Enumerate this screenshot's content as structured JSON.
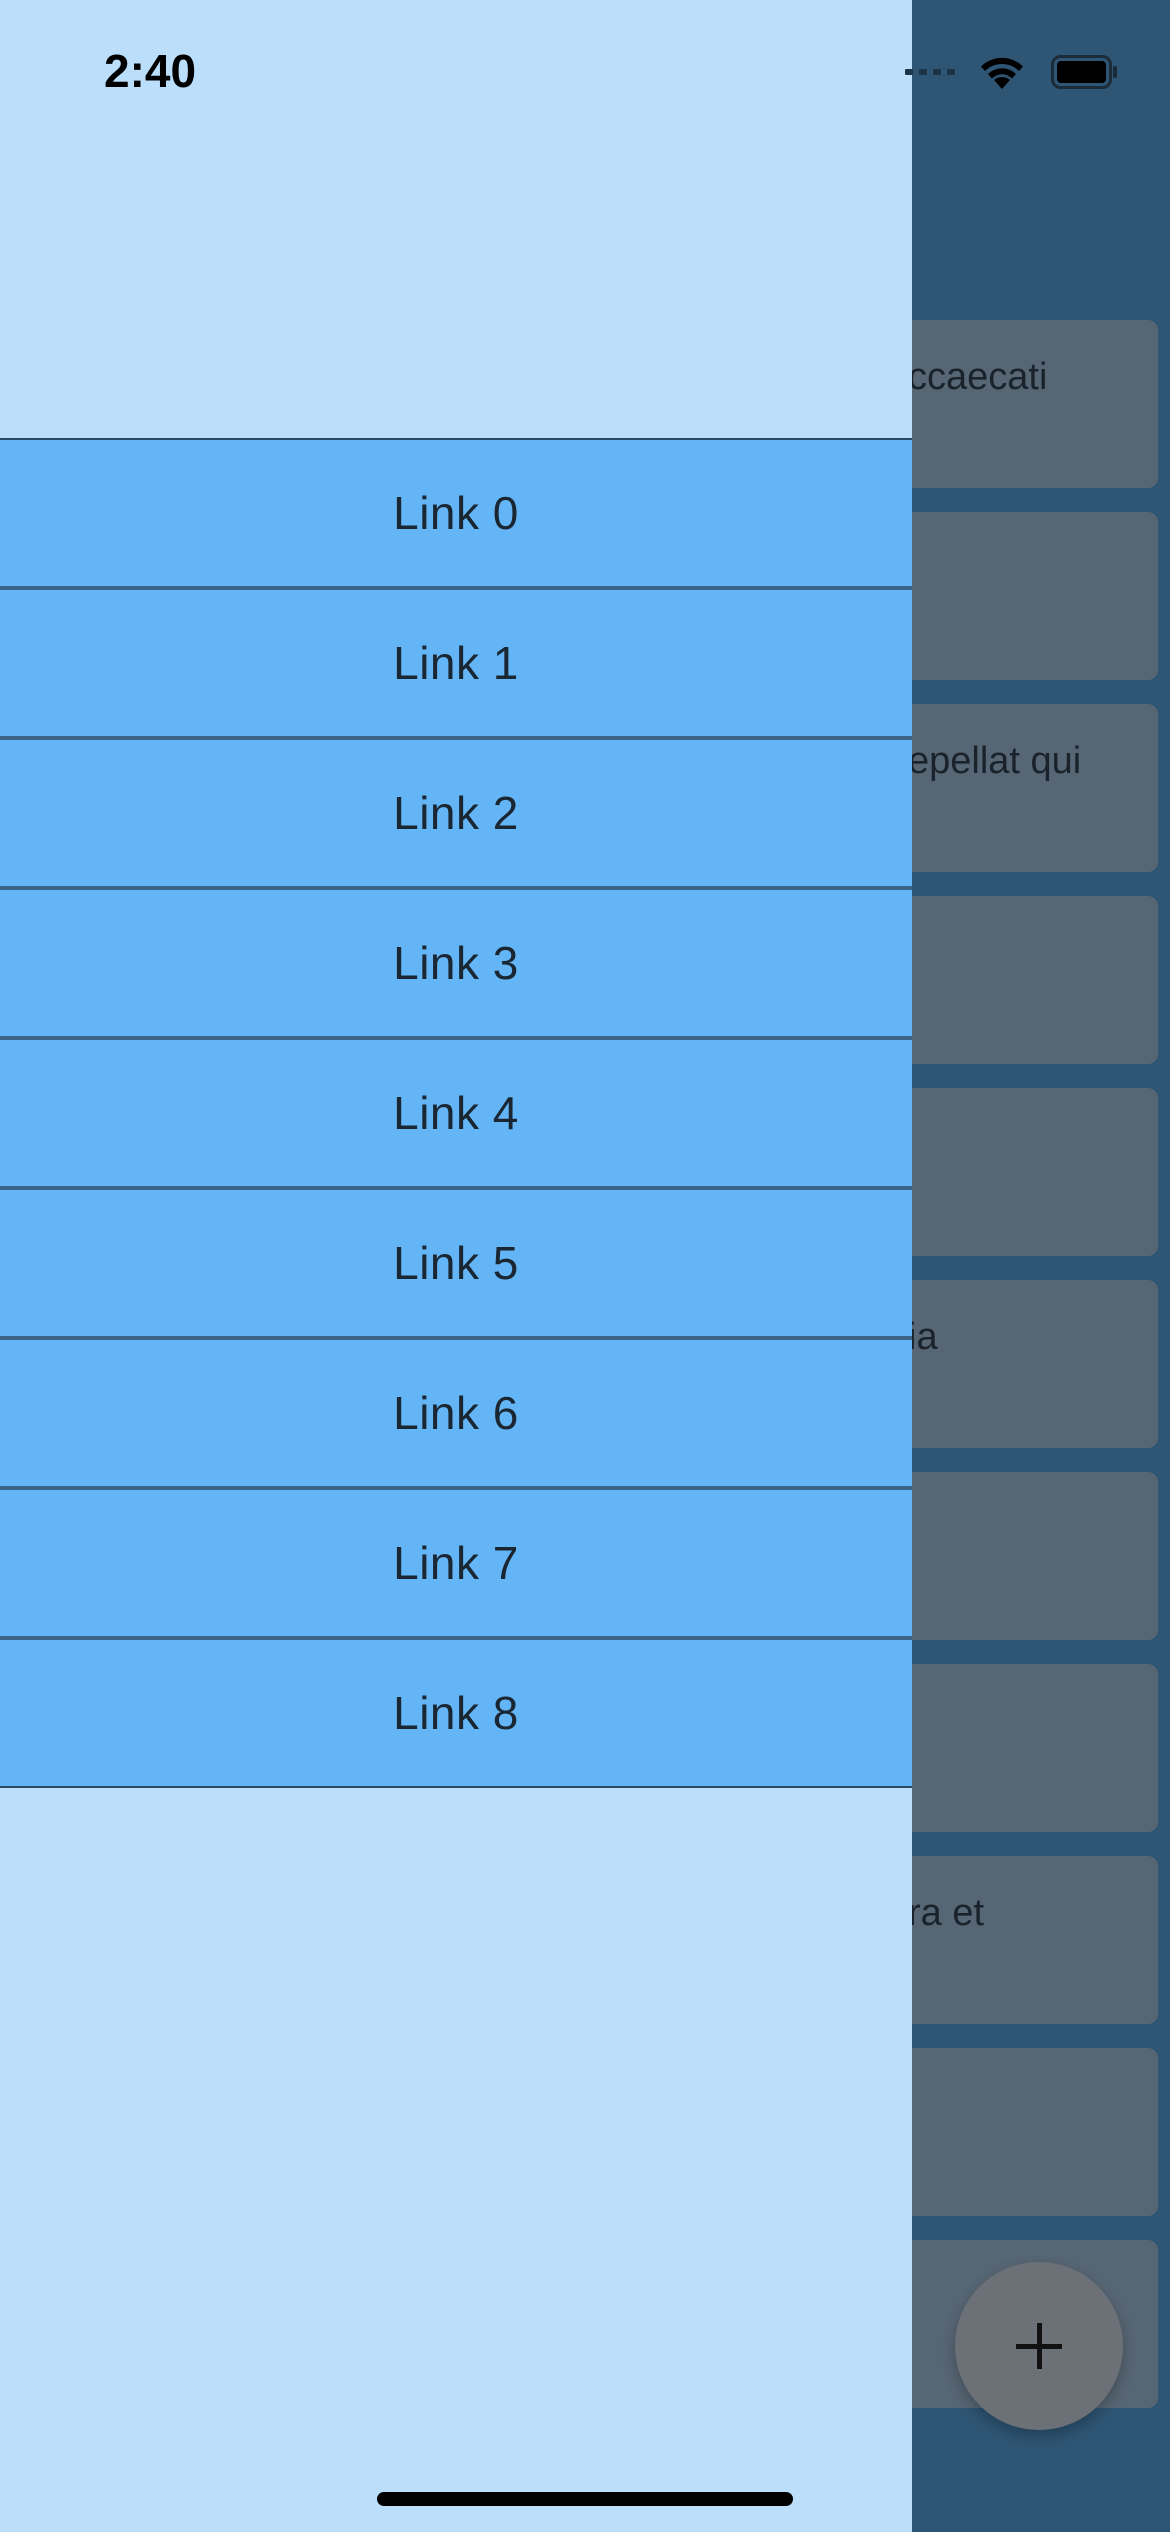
{
  "status_bar": {
    "time": "2:40",
    "wifi_icon": "wifi-icon",
    "battery_icon": "battery-icon"
  },
  "drawer": {
    "links": [
      {
        "label": "Link 0"
      },
      {
        "label": "Link 1"
      },
      {
        "label": "Link 2"
      },
      {
        "label": "Link 3"
      },
      {
        "label": "Link 4"
      },
      {
        "label": "Link 5"
      },
      {
        "label": "Link 6"
      },
      {
        "label": "Link 7"
      },
      {
        "label": "Link 8"
      }
    ]
  },
  "background_list": {
    "items": [
      {
        "text": "ccaecati"
      },
      {
        "text": ""
      },
      {
        "text": "epellat qui"
      },
      {
        "text": ""
      },
      {
        "text": ""
      },
      {
        "text": "ia"
      },
      {
        "text": ""
      },
      {
        "text": ""
      },
      {
        "text": "ra et"
      },
      {
        "text": ""
      },
      {
        "text": ""
      }
    ]
  },
  "fab": {
    "icon": "plus-icon"
  },
  "colors": {
    "drawer_background": "#bbdefb",
    "link_background": "#64b5f6",
    "scrim_background": "#2e5574",
    "card_background": "#576674"
  }
}
